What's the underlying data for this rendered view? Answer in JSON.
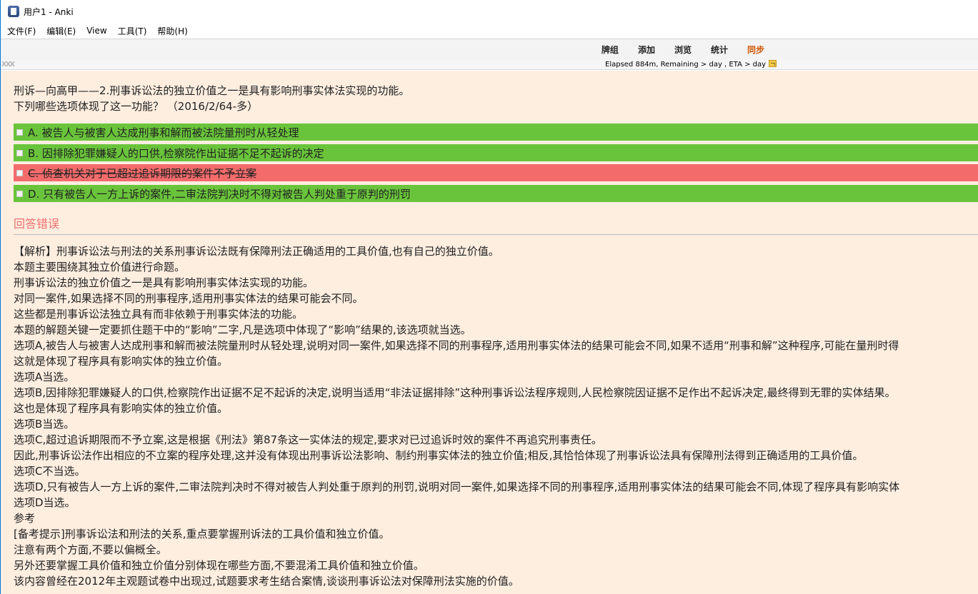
{
  "window": {
    "title": "用户1 - Anki"
  },
  "menu": [
    "文件(F)",
    "编辑(E)",
    "View",
    "工具(T)",
    "帮助(H)"
  ],
  "toolbar": {
    "decks": "牌组",
    "add": "添加",
    "browse": "浏览",
    "stats": "统计",
    "sync": "同步"
  },
  "status": {
    "mark": "XXX",
    "elapsed": "Elapsed 884m, Remaining > day , ETA > day"
  },
  "question": {
    "line1": "刑诉—向高甲——2.刑事诉讼法的独立价值之一是具有影响刑事实体法实现的功能。",
    "line2": "下列哪些选项体现了这一功能？ （2016/2/64-多）"
  },
  "options": [
    {
      "text": "A. 被告人与被害人达成刑事和解而被法院量刑时从轻处理",
      "state": "correct"
    },
    {
      "text": "B. 因排除犯罪嫌疑人的口供,检察院作出证据不足不起诉的决定",
      "state": "correct"
    },
    {
      "text": "C. 侦查机关对于已超过追诉期限的案件不予立案",
      "state": "wrong"
    },
    {
      "text": "D. 只有被告人一方上诉的案件,二审法院判决时不得对被告人判处重于原判的刑罚",
      "state": "correct"
    }
  ],
  "result": "回答错误",
  "explanation": [
    "【解析】刑事诉讼法与刑法的关系刑事诉讼法既有保障刑法正确适用的工具价值,也有自己的独立价值。",
    "本题主要围绕其独立价值进行命题。",
    "刑事诉讼法的独立价值之一是具有影响刑事实体法实现的功能。",
    "对同一案件,如果选择不同的刑事程序,适用刑事实体法的结果可能会不同。",
    "这些都是刑事诉讼法独立具有而非依赖于刑事实体法的功能。",
    "本题的解题关键一定要抓住题干中的“影响”二字,凡是选项中体现了“影响”结果的,该选项就当选。",
    "选项A,被告人与被害人达成刑事和解而被法院量刑时从轻处理,说明对同一案件,如果选择不同的刑事程序,适用刑事实体法的结果可能会不同,如果不适用“刑事和解”这种程序,可能在量刑时得",
    "这就是体现了程序具有影响实体的独立价值。",
    "选项A当选。",
    "选项B,因排除犯罪嫌疑人的口供,检察院作出证据不足不起诉的决定,说明当适用“非法证据排除”这种刑事诉讼法程序规则,人民检察院因证据不足作出不起诉决定,最终得到无罪的实体结果。",
    "这也是体现了程序具有影响实体的独立价值。",
    "选项B当选。",
    "选项C,超过追诉期限而不予立案,这是根据《刑法》第87条这一实体法的规定,要求对已过追诉时效的案件不再追究刑事责任。",
    "因此,刑事诉讼法作出相应的不立案的程序处理,这并没有体现出刑事诉讼法影响、制约刑事实体法的独立价值;相反,其恰恰体现了刑事诉讼法具有保障刑法得到正确适用的工具价值。",
    "选项C不当选。",
    "选项D,只有被告人一方上诉的案件,二审法院判决时不得对被告人判处重于原判的刑罚,说明对同一案件,如果选择不同的刑事程序,适用刑事实体法的结果可能会不同,体现了程序具有影响实体",
    "选项D当选。",
    "参考",
    "[备考提示]刑事诉讼法和刑法的关系,重点要掌握刑诉法的工具价值和独立价值。",
    "注意有两个方面,不要以偏概全。",
    "另外还要掌握工具价值和独立价值分别体现在哪些方面,不要混淆工具价值和独立价值。",
    "该内容曾经在2012年主观题试卷中出现过,试题要求考生结合案情,谈谈刑事诉讼法对保障刑法实施的价值。"
  ]
}
